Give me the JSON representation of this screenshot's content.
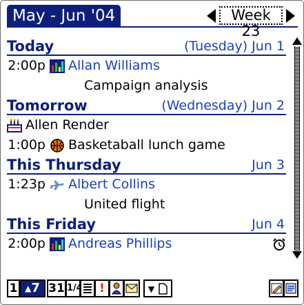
{
  "header": {
    "title": "May - Jun '04",
    "week_label": "Week 23"
  },
  "agenda": {
    "today": {
      "label": "Today",
      "date": "(Tuesday) Jun 1",
      "events": [
        {
          "time": "2:00p",
          "icon": "chart-icon",
          "name": "Allan Williams",
          "note": "Campaign analysis"
        }
      ]
    },
    "tomorrow": {
      "label": "Tomorrow",
      "date": "(Wednesday) Jun 2",
      "untimed": {
        "icon": "cake-icon",
        "text": "Allen Render"
      },
      "events": [
        {
          "time": "1:00p",
          "icon": "basketball-icon",
          "text": "Basketaball lunch game"
        }
      ]
    },
    "thursday": {
      "label": "This Thursday",
      "date": "Jun 3",
      "events": [
        {
          "time": "1:23p",
          "icon": "airplane-icon",
          "name": "Albert Collins",
          "note": "United flight"
        }
      ]
    },
    "friday": {
      "label": "This Friday",
      "date": "Jun 4",
      "events": [
        {
          "time": "2:00p",
          "icon": "chart-icon",
          "name": "Andreas Phillips",
          "alarm_icon": "alarm-clock-icon"
        }
      ]
    }
  },
  "toolbar": {
    "day_view": "1",
    "week_view": "7",
    "month_view": "31",
    "year_view": "1/4",
    "list_view_icon": "list-icon",
    "todo_icon": "exclamation-icon",
    "contacts_icon": "person-icon",
    "mail_icon": "envelope-icon",
    "menu_icon": "dropdown-icon",
    "new_icon": "new-document-icon",
    "edit_icon": "pencil-icon",
    "details_icon": "details-icon"
  },
  "colors": {
    "accent": "#0e1f7a",
    "link": "#1a3fbf"
  }
}
